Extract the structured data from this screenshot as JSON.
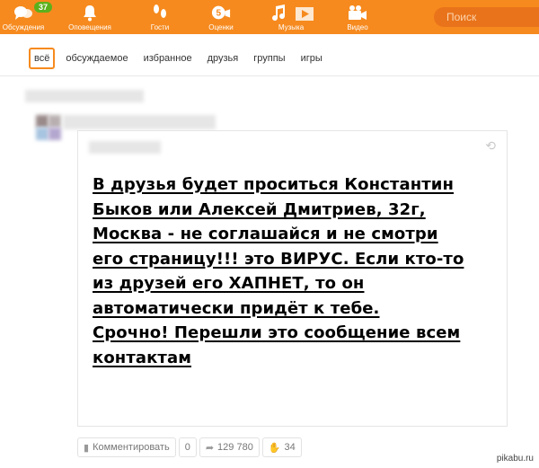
{
  "nav": {
    "items": [
      {
        "label": "Обсуждения",
        "icon": "chat-bubbles-icon"
      },
      {
        "label": "Оповещения",
        "icon": "bell-icon"
      },
      {
        "label": "Гости",
        "icon": "footprints-icon"
      },
      {
        "label": "Оценки",
        "icon": "rating-five-icon"
      },
      {
        "label": "Музыка",
        "icon": "music-note-icon"
      },
      {
        "label": "Видео",
        "icon": "video-camera-icon"
      }
    ],
    "badge": "37",
    "rating_digit": "5",
    "search_placeholder": "Поиск"
  },
  "tabs": [
    "всё",
    "обсуждаемое",
    "избранное",
    "друзья",
    "группы",
    "игры"
  ],
  "post": {
    "text": "В друзья будет проситься Константин\nБыков или Алексей Дмитриев, 32г,\nМосква - не соглашайся и не смотри\nего страницу!!! это ВИРУС. Если кто-то\nиз друзей его ХАПНЕТ, то он\nавтоматически придёт к тебе.\nСрочно! Перешли это сообщение всем\nконтактам"
  },
  "actions": {
    "comment_label": "Комментировать",
    "comment_count": "0",
    "reshare_count": "129 780",
    "like_count": "34"
  },
  "watermark": "pikabu.ru",
  "colors": {
    "brand": "#f68a1e",
    "badge": "#5cb01c"
  }
}
